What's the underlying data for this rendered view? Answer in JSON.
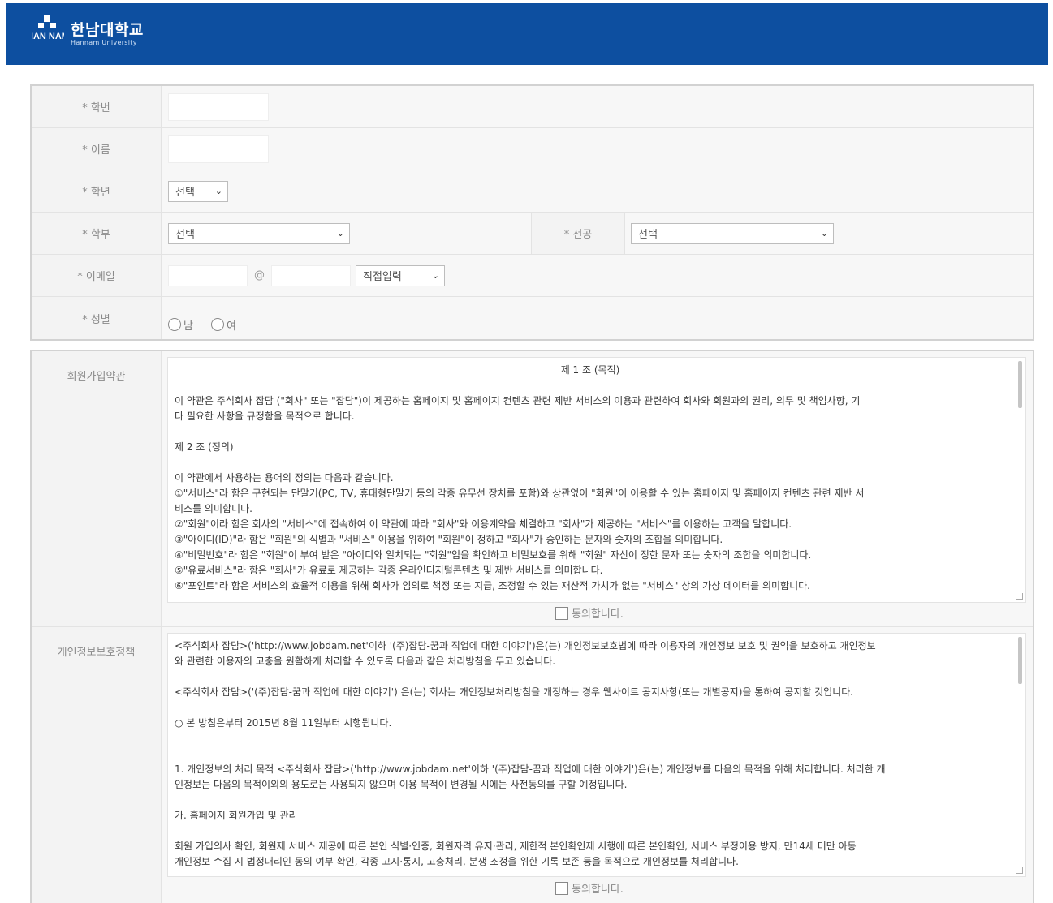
{
  "header": {
    "logo_mark_text": "HAN NAM",
    "logo_ko": "한남대학교",
    "logo_en": "Hannam University",
    "bg_color": "#0d4fa0"
  },
  "form": {
    "student_id": {
      "label": "* 학번",
      "value": ""
    },
    "name": {
      "label": "* 이름",
      "value": ""
    },
    "grade": {
      "label": "* 학년",
      "selected": "선택"
    },
    "faculty": {
      "label": "* 학부",
      "selected": "선택"
    },
    "major": {
      "label": "* 전공",
      "selected": "선택"
    },
    "email": {
      "label": "* 이메일",
      "local": "",
      "at": "@",
      "domain": "",
      "domain_select": "직접입력"
    },
    "gender": {
      "label": "* 성별",
      "options": [
        "남",
        "여"
      ]
    }
  },
  "terms": {
    "label": "회원가입약관",
    "lines": [
      "제 1 조 (목적)",
      "",
      "이 약관은 주식회사 잡담 (\"회사\" 또는 \"잡담\")이 제공하는 홈페이지 및 홈페이지 컨텐츠 관련 제반 서비스의 이용과 관련하여 회사와 회원과의 권리, 의무 및 책임사항, 기",
      "타 필요한 사항을 규정함을 목적으로 합니다.",
      "",
      "제 2 조 (정의)",
      "",
      "이 약관에서 사용하는 용어의 정의는 다음과 같습니다.",
      "①\"서비스\"라 함은 구현되는 단말기(PC, TV, 휴대형단말기 등의 각종 유무선 장치를 포함)와 상관없이 \"회원\"이 이용할 수 있는 홈페이지 및 홈페이지 컨텐츠 관련 제반 서",
      "비스를 의미합니다.",
      "②\"회원\"이라 함은 회사의 \"서비스\"에 접속하여 이 약관에 따라 \"회사\"와 이용계약을 체결하고 \"회사\"가 제공하는 \"서비스\"를 이용하는 고객을 말합니다.",
      "③\"아이디(ID)\"라 함은 \"회원\"의 식별과 \"서비스\" 이용을 위하여 \"회원\"이 정하고 \"회사\"가 승인하는 문자와 숫자의 조합을 의미합니다.",
      "④\"비밀번호\"라 함은 \"회원\"이 부여 받은 \"아이디와 일치되는 \"회원\"임을 확인하고 비밀보호를 위해 \"회원\" 자신이 정한 문자 또는 숫자의 조합을 의미합니다.",
      "⑤\"유료서비스\"라 함은 \"회사\"가 유료로 제공하는 각종 온라인디지털콘텐츠 및 제반 서비스를 의미합니다.",
      "⑥\"포인트\"라 함은 서비스의 효율적 이용을 위해 회사가 임의로 책정 또는 지급, 조정할 수 있는 재산적 가치가 없는 \"서비스\" 상의 가상 데이터를 의미합니다."
    ],
    "agree_label": "동의합니다."
  },
  "privacy": {
    "label": "개인정보보호정책",
    "lines": [
      "<주식회사 잡담>('http://www.jobdam.net'이하 '(주)잡담-꿈과 직업에 대한 이야기')은(는) 개인정보보호법에 따라 이용자의 개인정보 보호 및 권익을 보호하고 개인정보",
      "와 관련한 이용자의 고충을 원활하게 처리할 수 있도록 다음과 같은 처리방침을 두고 있습니다.",
      "",
      "<주식회사 잡담>('(주)잡담-꿈과 직업에 대한 이야기') 은(는) 회사는 개인정보처리방침을 개정하는 경우 웹사이트 공지사항(또는 개별공지)을 통하여 공지할 것입니다.",
      "",
      "○ 본 방침은부터 2015년 8월 11일부터 시행됩니다.",
      "",
      "",
      "1. 개인정보의 처리 목적 <주식회사 잡담>('http://www.jobdam.net'이하 '(주)잡담-꿈과 직업에 대한 이야기')은(는) 개인정보를 다음의 목적을 위해 처리합니다. 처리한 개",
      "인정보는 다음의 목적이외의 용도로는 사용되지 않으며 이용 목적이 변경될 시에는 사전동의를 구할 예정입니다.",
      "",
      "가. 홈페이지 회원가입 및 관리",
      "",
      "회원 가입의사 확인, 회원제 서비스 제공에 따른 본인 식별·인증, 회원자격 유지·관리, 제한적 본인확인제 시행에 따른 본인확인, 서비스 부정이용 방지, 만14세 미만 아동",
      "개인정보 수집 시 법정대리인 동의 여부 확인, 각종 고지·통지, 고충처리, 분쟁 조정을 위한 기록 보존 등을 목적으로 개인정보를 처리합니다."
    ],
    "agree_label": "동의합니다."
  }
}
